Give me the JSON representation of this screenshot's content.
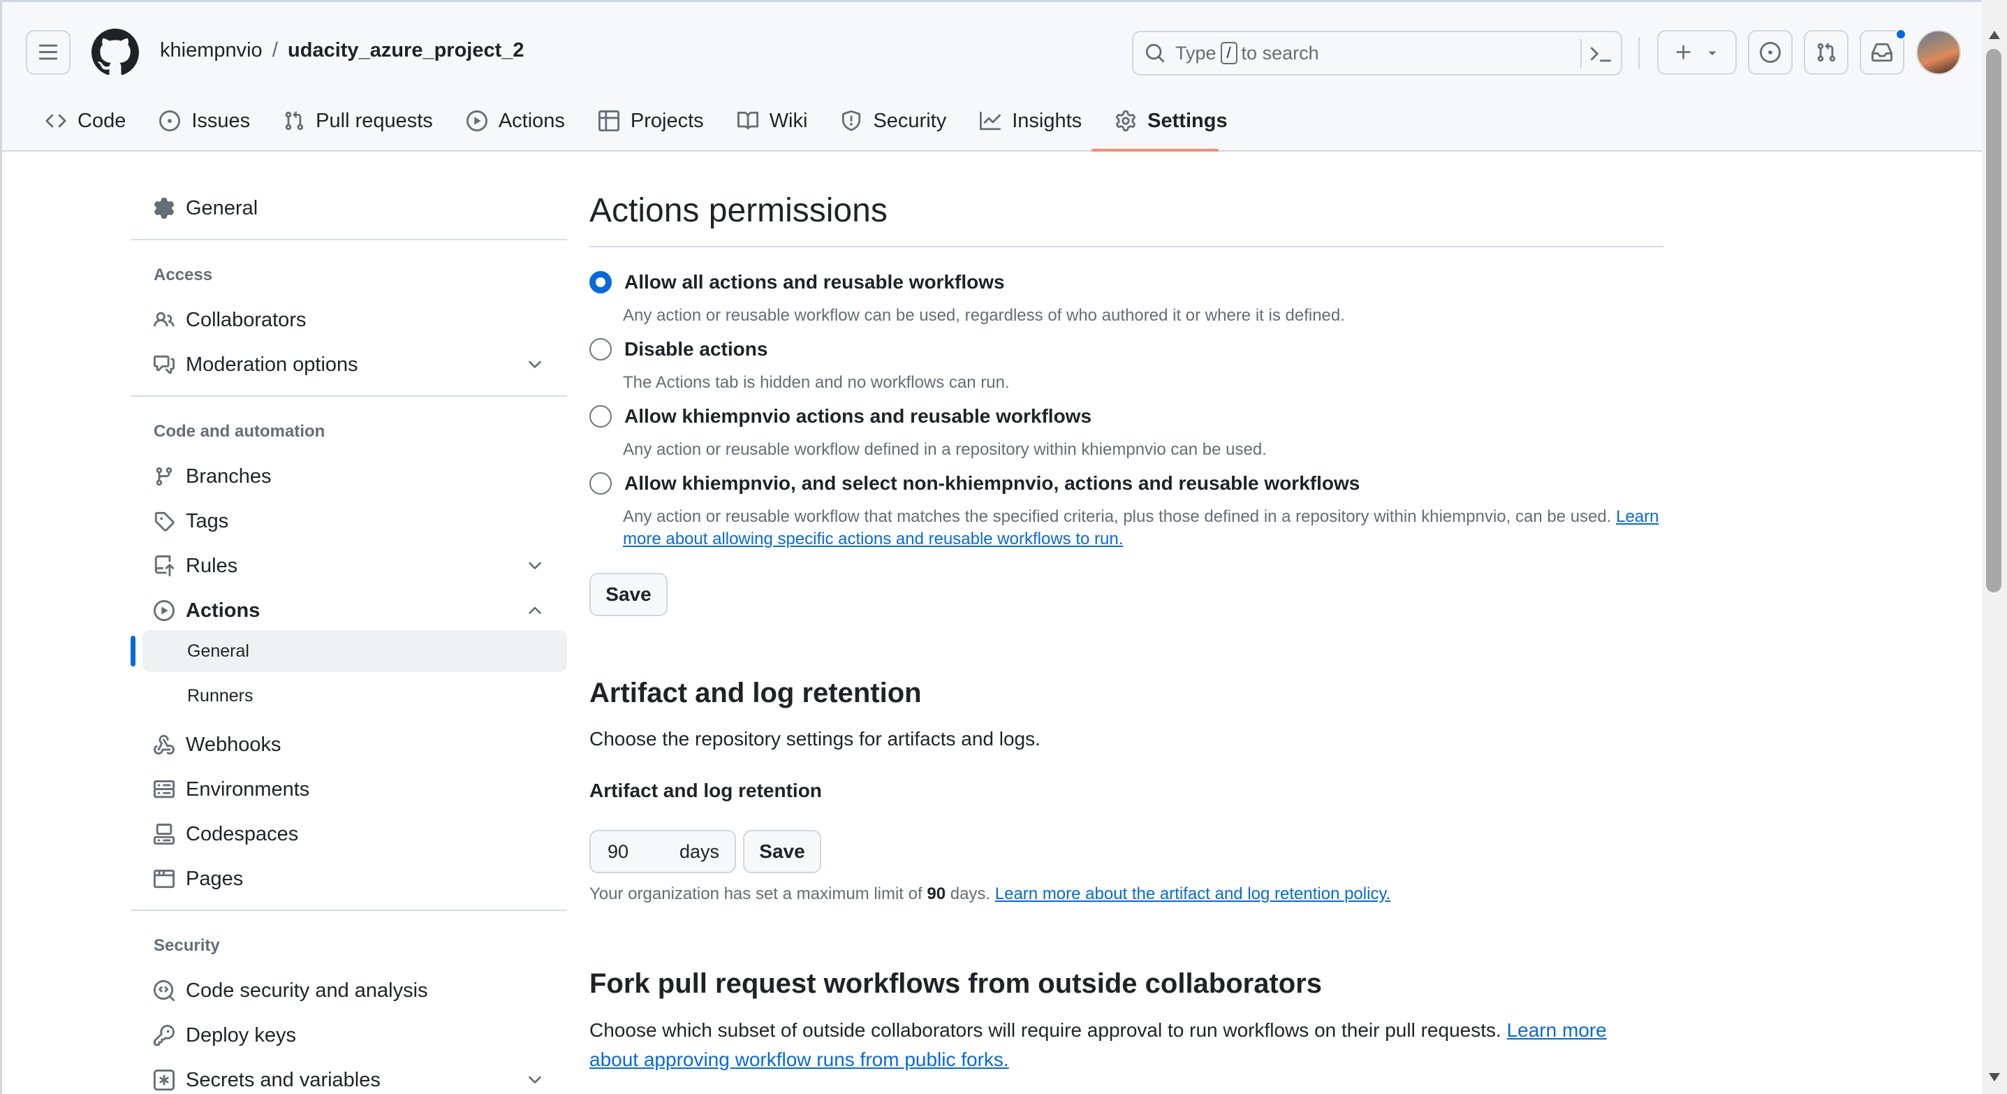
{
  "header": {
    "owner": "khiempnvio",
    "separator": "/",
    "repo": "udacity_azure_project_2",
    "search_prefix": "Type",
    "search_key": "/",
    "search_suffix": "to search"
  },
  "repo_nav": [
    {
      "label": "Code",
      "icon": "code-icon"
    },
    {
      "label": "Issues",
      "icon": "issue-opened-icon"
    },
    {
      "label": "Pull requests",
      "icon": "git-pull-request-icon"
    },
    {
      "label": "Actions",
      "icon": "play-icon"
    },
    {
      "label": "Projects",
      "icon": "table-icon"
    },
    {
      "label": "Wiki",
      "icon": "book-icon"
    },
    {
      "label": "Security",
      "icon": "shield-icon"
    },
    {
      "label": "Insights",
      "icon": "graph-icon"
    },
    {
      "label": "Settings",
      "icon": "gear-icon",
      "active": true
    }
  ],
  "sidebar": {
    "general": "General",
    "access_heading": "Access",
    "collaborators": "Collaborators",
    "moderation": "Moderation options",
    "code_heading": "Code and automation",
    "branches": "Branches",
    "tags": "Tags",
    "rules": "Rules",
    "actions": "Actions",
    "actions_general": "General",
    "actions_runners": "Runners",
    "webhooks": "Webhooks",
    "environments": "Environments",
    "codespaces": "Codespaces",
    "pages": "Pages",
    "security_heading": "Security",
    "code_security": "Code security and analysis",
    "deploy_keys": "Deploy keys",
    "secrets": "Secrets and variables"
  },
  "permissions": {
    "title": "Actions permissions",
    "options": [
      {
        "label": "Allow all actions and reusable workflows",
        "note": "Any action or reusable workflow can be used, regardless of who authored it or where it is defined.",
        "checked": true
      },
      {
        "label": "Disable actions",
        "note": "The Actions tab is hidden and no workflows can run.",
        "checked": false
      },
      {
        "label": "Allow khiempnvio actions and reusable workflows",
        "note": "Any action or reusable workflow defined in a repository within khiempnvio can be used.",
        "checked": false
      },
      {
        "label": "Allow khiempnvio, and select non-khiempnvio, actions and reusable workflows",
        "note": "Any action or reusable workflow that matches the specified criteria, plus those defined in a repository within khiempnvio, can be used.",
        "link": "Learn more about allowing specific actions and reusable workflows to run.",
        "checked": false
      }
    ],
    "save": "Save"
  },
  "retention": {
    "title": "Artifact and log retention",
    "description": "Choose the repository settings for artifacts and logs.",
    "field_label": "Artifact and log retention",
    "value": "90",
    "unit": "days",
    "save": "Save",
    "note_prefix": "Your organization has set a maximum limit of",
    "note_value": "90",
    "note_suffix": "days.",
    "note_link": "Learn more about the artifact and log retention policy."
  },
  "fork": {
    "title": "Fork pull request workflows from outside collaborators",
    "description": "Choose which subset of outside collaborators will require approval to run workflows on their pull requests.",
    "link": "Learn more about approving workflow runs from public forks."
  }
}
